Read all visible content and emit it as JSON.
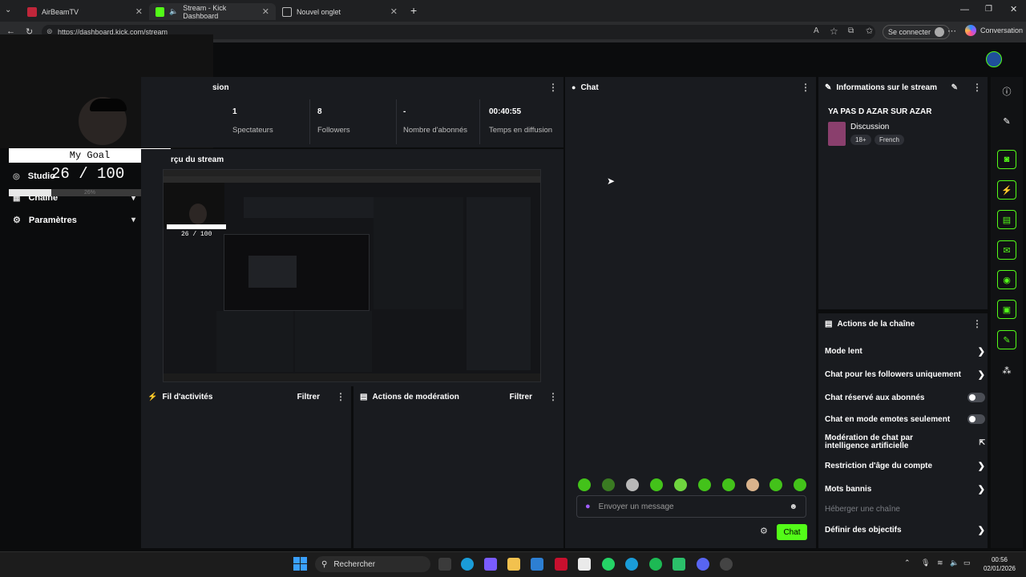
{
  "browser": {
    "tabs": [
      {
        "title": "AirBeamTV",
        "active": false
      },
      {
        "title": "Stream - Kick Dashboard",
        "active": true
      },
      {
        "title": "Nouvel onglet",
        "active": false
      }
    ],
    "url": "https://dashboard.kick.com/stream",
    "signin_label": "Se connecter",
    "copilot_label": "Conversation"
  },
  "goal": {
    "title": "My Goal",
    "count": "26 / 100",
    "percent_label": "26%",
    "progress": 0.26
  },
  "sidebar": {
    "items": [
      {
        "label": "Studio"
      },
      {
        "label": "Chaîne"
      },
      {
        "label": "Paramètres"
      }
    ]
  },
  "session": {
    "header": "sion",
    "stats": [
      {
        "value": "1",
        "label": "Spectateurs"
      },
      {
        "value": "8",
        "label": "Followers"
      },
      {
        "value": "-",
        "label": "Nombre d'abonnés"
      },
      {
        "value": "00:40:55",
        "label": "Temps en diffusion"
      }
    ]
  },
  "preview": {
    "header": "rçu du stream",
    "mini_goal_count": "26 / 100"
  },
  "activity": {
    "title": "Fil d'activités",
    "filter": "Filtrer"
  },
  "moderation": {
    "title": "Actions de modération",
    "filter": "Filtrer"
  },
  "chat": {
    "title": "Chat",
    "input_placeholder": "Envoyer un message",
    "send_label": "Chat"
  },
  "stream_info": {
    "title": "Informations sur le stream",
    "stream_title": "YA PAS D AZAR SUR AZAR",
    "category": "Discussion",
    "tags": [
      "18+",
      "French"
    ]
  },
  "channel_actions": {
    "title": "Actions de la chaîne",
    "items": [
      {
        "label": "Mode lent",
        "control": "arrow"
      },
      {
        "label": "Chat pour les followers uniquement",
        "control": "arrow"
      },
      {
        "label": "Chat réservé aux abonnés",
        "control": "toggle"
      },
      {
        "label": "Chat en mode emotes seulement",
        "control": "toggle"
      },
      {
        "label": "Modération de chat par intelligence artificielle",
        "control": "external"
      },
      {
        "label": "Restriction d'âge du compte",
        "control": "arrow"
      },
      {
        "label": "Mots bannis",
        "control": "arrow"
      },
      {
        "label": "Héberger une chaîne",
        "control": "none"
      },
      {
        "label": "Définir des objectifs",
        "control": "arrow"
      }
    ]
  },
  "taskbar": {
    "search_label": "Rechercher",
    "time": "00:56",
    "date": "02/01/2026"
  },
  "colors": {
    "accent": "#53fc18",
    "panel": "#191b1f",
    "background": "#0b0c0d"
  }
}
